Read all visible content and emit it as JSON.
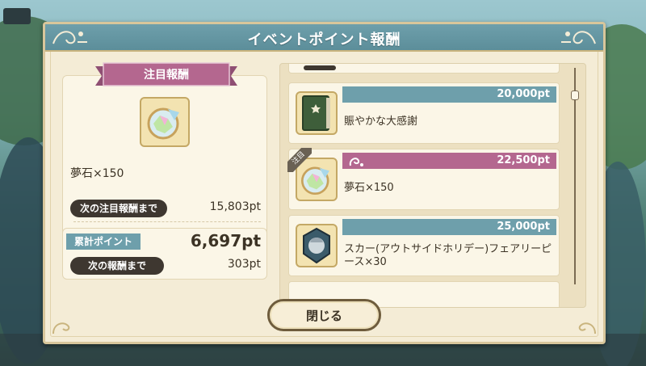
{
  "dialog": {
    "title": "イベントポイント報酬",
    "close_label": "閉じる"
  },
  "featured": {
    "ribbon_label": "注目報酬",
    "item_name": "夢石×150",
    "next_featured_label": "次の注目報酬まで",
    "next_featured_value": "15,803pt"
  },
  "points": {
    "cumulative_label": "累計ポイント",
    "cumulative_value": "6,697pt",
    "next_reward_label": "次の報酬まで",
    "next_reward_value": "303pt"
  },
  "rewards": [
    {
      "points": "20,000pt",
      "name": "賑やかな大感謝",
      "highlight": false,
      "icon": "book-icon"
    },
    {
      "points": "22,500pt",
      "name": "夢石×150",
      "highlight": true,
      "badge": "注目",
      "icon": "dream-stone-icon"
    },
    {
      "points": "25,000pt",
      "name": "スカー(アウトサイドホリデー)フェアリーピース×30",
      "highlight": false,
      "icon": "fairy-piece-icon"
    }
  ],
  "colors": {
    "teal": "#6e9fab",
    "pink": "#b4678f",
    "cream": "#f4ecd6",
    "dark_pill": "#3e3730"
  }
}
